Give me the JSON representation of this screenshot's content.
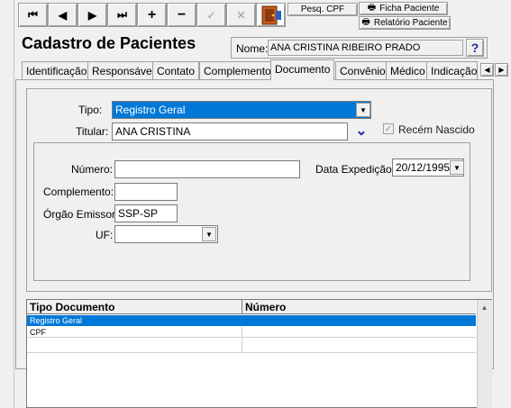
{
  "toolbar": {
    "first": "⏮",
    "prev": "◀",
    "next": "▶",
    "last": "⏭",
    "add": "+",
    "remove": "−",
    "confirm": "✓",
    "cancel": "✕",
    "pesq_cpf": "Pesq. CPF",
    "ficha_paciente": "Ficha Paciente",
    "relatorio_paciente": "Relatório Paciente"
  },
  "header": {
    "title": "Cadastro de Pacientes",
    "name_label": "Nome:",
    "name_value": "ANA CRISTINA RIBEIRO PRADO",
    "help": "?"
  },
  "tabs": [
    "Identificação",
    "Responsável",
    "Contato",
    "Complemento",
    "Documento",
    "Convênio",
    "Médico",
    "Indicação"
  ],
  "form": {
    "tipo_label": "Tipo:",
    "tipo_value": "Registro Geral",
    "titular_label": "Titular:",
    "titular_value": "ANA CRISTINA",
    "recem_nascido_label": "Recém Nascido",
    "numero_label": "Número:",
    "numero_value": "",
    "data_expedicao_label": "Data Expedição:",
    "data_expedicao_value": "20/12/1995",
    "complemento_label": "Complemento:",
    "complemento_value": "",
    "orgao_label": "Órgão Emissor:",
    "orgao_value": "SSP-SP",
    "uf_label": "UF:",
    "uf_value": ""
  },
  "grid": {
    "columns": [
      "Tipo Documento",
      "Número"
    ],
    "rows": [
      {
        "tipo": "Registro Geral",
        "numero": "",
        "selected": true
      },
      {
        "tipo": "CPF",
        "numero": "",
        "selected": false
      },
      {
        "tipo": "",
        "numero": "",
        "selected": false
      }
    ]
  },
  "colors": {
    "selection": "#0078d7",
    "accent_blue": "#1f2b9c"
  }
}
